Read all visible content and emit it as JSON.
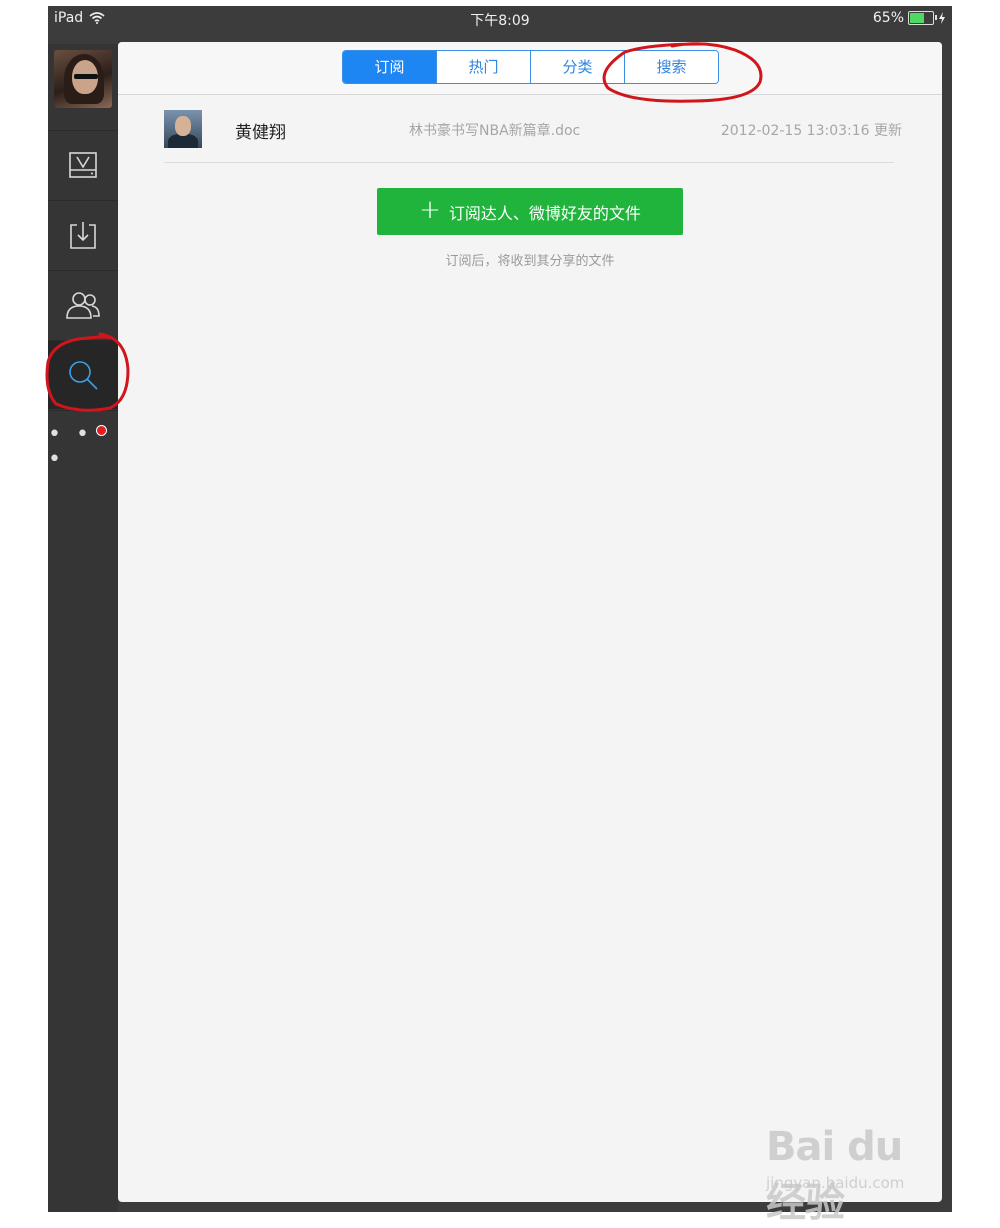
{
  "status_bar": {
    "device": "iPad",
    "time": "下午8:09",
    "battery": "65%",
    "battery_level": 0.65
  },
  "sidebar": {
    "items": [
      {
        "name": "v-drive-icon"
      },
      {
        "name": "download-icon"
      },
      {
        "name": "people-icon"
      },
      {
        "name": "search-icon",
        "active": true
      },
      {
        "name": "more-dots-icon",
        "label": "• • •"
      }
    ]
  },
  "tabs": [
    {
      "label": "订阅",
      "selected": true
    },
    {
      "label": "热门"
    },
    {
      "label": "分类"
    },
    {
      "label": "搜索"
    }
  ],
  "subscription": {
    "name": "黄健翔",
    "file": "林书豪书写NBA新篇章.doc",
    "updated": "2012-02-15 13:03:16 更新"
  },
  "subscribe_button": {
    "plus": "+",
    "label": "订阅达人、微博好友的文件"
  },
  "hint": "订阅后，将收到其分享的文件",
  "watermark": {
    "main": "Bai du 经验",
    "sub": "jingyan.baidu.com"
  },
  "colors": {
    "accent": "#1d86f2",
    "green": "#20b43c",
    "annotation": "#d0161b"
  }
}
